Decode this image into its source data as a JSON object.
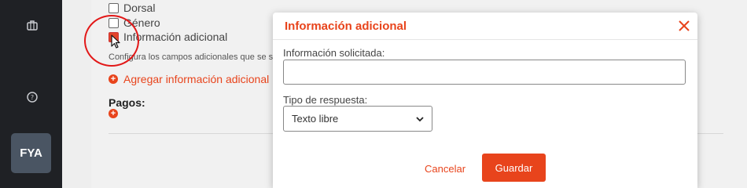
{
  "sidebar": {
    "icons": [
      "briefcase-icon",
      "help-circle-icon"
    ],
    "avatar_initials": "FYA"
  },
  "form": {
    "checkboxes": [
      {
        "label": "Dorsal",
        "checked": false
      },
      {
        "label": "Género",
        "checked": false
      },
      {
        "label": "Información adicional",
        "checked": true
      }
    ],
    "help_text": "Configura los campos adicionales que se so",
    "add_info_label": "Agregar información adicional",
    "pagos_label": "Pagos:"
  },
  "modal": {
    "title": "Información adicional",
    "info_label": "Información solicitada:",
    "info_value": "",
    "tipo_label": "Tipo de respuesta:",
    "tipo_selected": "Texto libre",
    "cancel_label": "Cancelar",
    "save_label": "Guardar"
  },
  "colors": {
    "accent": "#e8441c",
    "sidebar_bg": "#1f2125",
    "highlight_circle": "#e21818"
  }
}
